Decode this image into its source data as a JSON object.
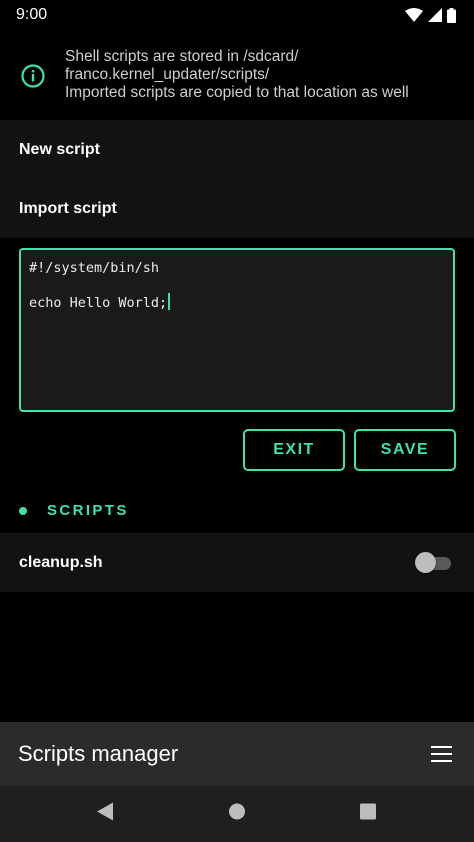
{
  "status_bar": {
    "time": "9:00",
    "icons": [
      "wifi-icon",
      "signal-icon",
      "battery-icon"
    ]
  },
  "info_banner": {
    "icon": "info-icon",
    "lines": [
      "Shell scripts are stored in /sdcard/",
      "franco.kernel_updater/scripts/",
      "Imported scripts are copied to that location as well"
    ]
  },
  "menu": {
    "new_script": "New script",
    "import_script": "Import script"
  },
  "editor": {
    "lines": [
      "#!/system/bin/sh",
      "",
      "echo Hello World;"
    ]
  },
  "buttons": {
    "exit": "EXIT",
    "save": "SAVE"
  },
  "scripts_section": {
    "title": "SCRIPTS",
    "items": [
      {
        "name": "cleanup.sh",
        "enabled": false
      }
    ]
  },
  "app_bar": {
    "title": "Scripts manager",
    "menu_icon": "hamburger-menu-icon"
  },
  "nav_bar": {
    "icons": [
      "back-icon",
      "home-icon",
      "recents-icon"
    ]
  },
  "colors": {
    "accent": "#3ee0b1",
    "background": "#000000",
    "surface": "#121212",
    "app_bar": "#2b2b2b"
  }
}
